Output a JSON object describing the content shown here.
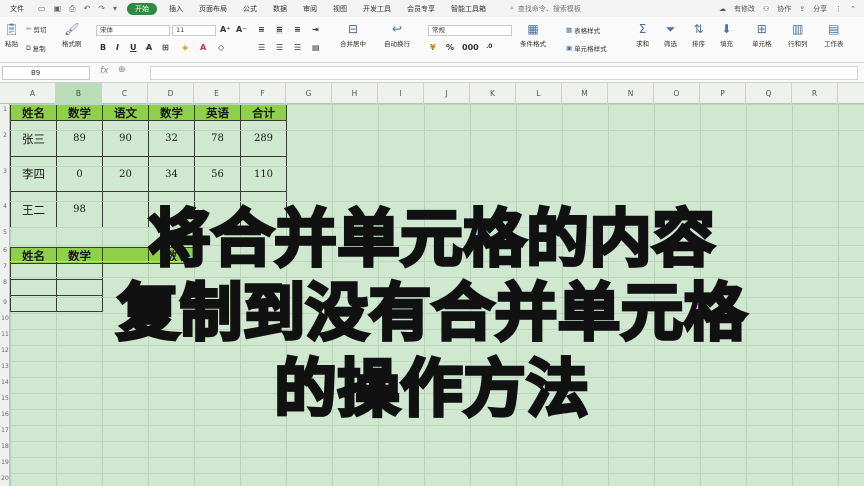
{
  "menubar": {
    "file": "文件",
    "tabs": [
      "开始",
      "插入",
      "页面布局",
      "公式",
      "数据",
      "审阅",
      "视图",
      "开发工具",
      "会员专享",
      "智能工具箱"
    ],
    "active_tab": "开始",
    "search": "查找命令、搜索模板",
    "right": [
      "有修改",
      "协作",
      "分享"
    ]
  },
  "ribbon": {
    "cut": "剪切",
    "copy": "复制",
    "format_painter": "格式刷",
    "paste": "粘贴",
    "font_name": "宋体",
    "font_size": "11",
    "merge_center": "合并居中",
    "wrap": "自动换行",
    "number_format": "常规",
    "conditional": "条件格式",
    "table_style": "表格样式",
    "cell_style": "单元格样式",
    "sum": "求和",
    "filter": "筛选",
    "sort": "排序",
    "fill": "填充",
    "cells": "单元格",
    "rowcol": "行和列",
    "worksheet": "工作表"
  },
  "formula_bar": {
    "name_box": "B9",
    "fx": "fx"
  },
  "sheet": {
    "columns": [
      "A",
      "B",
      "C",
      "D",
      "E",
      "F",
      "G",
      "H",
      "I",
      "J",
      "K",
      "L",
      "M",
      "N",
      "O",
      "P",
      "Q",
      "R"
    ],
    "selected_column": "B",
    "row_numbers": [
      "1",
      "2",
      "3",
      "4",
      "5",
      "6",
      "7",
      "8",
      "9",
      "10",
      "11",
      "12",
      "13",
      "14",
      "15",
      "16",
      "17",
      "18",
      "19",
      "20",
      "21"
    ],
    "table1": {
      "headers": [
        "姓名",
        "数学",
        "语文",
        "数学",
        "英语",
        "合计"
      ],
      "rows": [
        [
          "张三",
          "89",
          "90",
          "32",
          "78",
          "289"
        ],
        [
          "李四",
          "0",
          "20",
          "34",
          "56",
          "110"
        ],
        [
          "王二",
          "98",
          "",
          "",
          "",
          ""
        ]
      ]
    },
    "table2": {
      "headers": [
        "姓名",
        "数学",
        "",
        "数"
      ]
    }
  },
  "caption": {
    "line1": "将合并单元格的内容",
    "line2": "复制到没有合并单元格",
    "line3": "的操作方法"
  }
}
